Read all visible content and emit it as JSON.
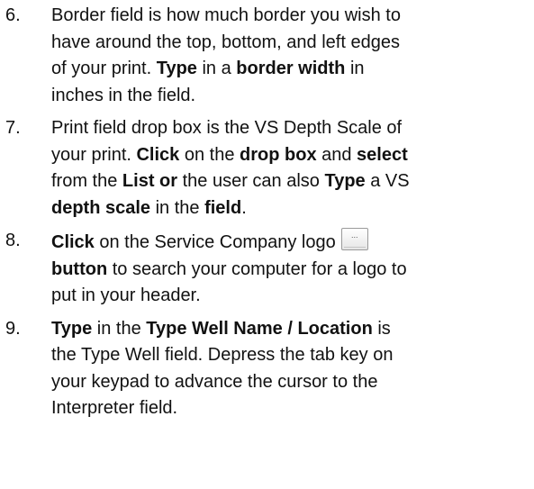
{
  "steps": [
    {
      "number": "6.",
      "lines": [
        [
          {
            "t": "Border field is how much border you wish to"
          }
        ],
        [
          {
            "t": "have around the top, bottom, and left edges"
          }
        ],
        [
          {
            "t": "of your print. "
          },
          {
            "t": "Type",
            "b": true
          },
          {
            "t": " in a "
          },
          {
            "t": "border width",
            "b": true
          },
          {
            "t": " in"
          }
        ],
        [
          {
            "t": "inches in the field."
          }
        ]
      ]
    },
    {
      "number": "7.",
      "lines": [
        [
          {
            "t": "Print field drop box is the VS Depth Scale of"
          }
        ],
        [
          {
            "t": "your print. "
          },
          {
            "t": "Click",
            "b": true
          },
          {
            "t": " on the "
          },
          {
            "t": "drop box",
            "b": true
          },
          {
            "t": " and "
          },
          {
            "t": "select",
            "b": true
          }
        ],
        [
          {
            "t": "from the "
          },
          {
            "t": "List or",
            "b": true
          },
          {
            "t": " the user can also "
          },
          {
            "t": "Type",
            "b": true
          },
          {
            "t": " a VS"
          }
        ],
        [
          {
            "t": "depth scale",
            "b": true
          },
          {
            "t": " in the "
          },
          {
            "t": "field",
            "b": true
          },
          {
            "t": "."
          }
        ]
      ]
    },
    {
      "number": "8.",
      "lines": [
        [
          {
            "t": "Click",
            "b": true
          },
          {
            "t": " on the Service Company logo"
          },
          {
            "button": "logo-browse",
            "label": "..."
          }
        ],
        [
          {
            "t": "button",
            "b": true
          },
          {
            "t": " to search your computer for a logo to"
          }
        ],
        [
          {
            "t": "put in your header."
          }
        ]
      ]
    },
    {
      "number": "9.",
      "lines": [
        [
          {
            "t": "Type",
            "b": true
          },
          {
            "t": " in the "
          },
          {
            "t": "Type Well Name / Location",
            "b": true
          },
          {
            "t": " is"
          }
        ],
        [
          {
            "t": "the Type Well field. Depress the tab key on"
          }
        ],
        [
          {
            "t": "your keypad to advance the cursor to the"
          }
        ],
        [
          {
            "t": "Interpreter field."
          }
        ]
      ]
    }
  ]
}
